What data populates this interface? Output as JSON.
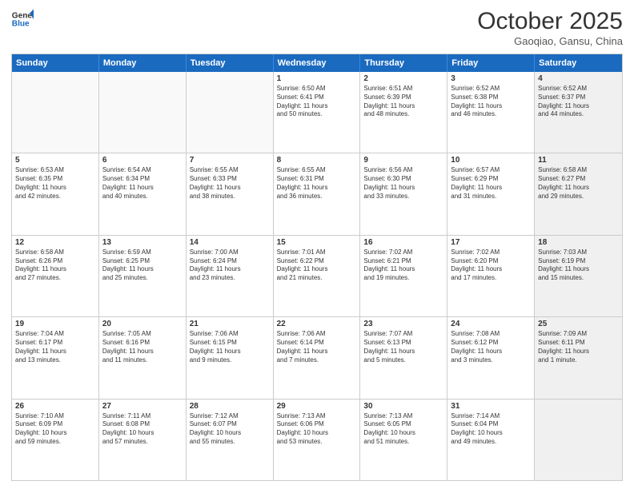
{
  "header": {
    "logo_line1": "General",
    "logo_line2": "Blue",
    "month": "October 2025",
    "location": "Gaoqiao, Gansu, China"
  },
  "weekdays": [
    "Sunday",
    "Monday",
    "Tuesday",
    "Wednesday",
    "Thursday",
    "Friday",
    "Saturday"
  ],
  "rows": [
    [
      {
        "day": "",
        "text": "",
        "empty": true
      },
      {
        "day": "",
        "text": "",
        "empty": true
      },
      {
        "day": "",
        "text": "",
        "empty": true
      },
      {
        "day": "1",
        "text": "Sunrise: 6:50 AM\nSunset: 6:41 PM\nDaylight: 11 hours\nand 50 minutes."
      },
      {
        "day": "2",
        "text": "Sunrise: 6:51 AM\nSunset: 6:39 PM\nDaylight: 11 hours\nand 48 minutes."
      },
      {
        "day": "3",
        "text": "Sunrise: 6:52 AM\nSunset: 6:38 PM\nDaylight: 11 hours\nand 46 minutes."
      },
      {
        "day": "4",
        "text": "Sunrise: 6:52 AM\nSunset: 6:37 PM\nDaylight: 11 hours\nand 44 minutes.",
        "shaded": true
      }
    ],
    [
      {
        "day": "5",
        "text": "Sunrise: 6:53 AM\nSunset: 6:35 PM\nDaylight: 11 hours\nand 42 minutes."
      },
      {
        "day": "6",
        "text": "Sunrise: 6:54 AM\nSunset: 6:34 PM\nDaylight: 11 hours\nand 40 minutes."
      },
      {
        "day": "7",
        "text": "Sunrise: 6:55 AM\nSunset: 6:33 PM\nDaylight: 11 hours\nand 38 minutes."
      },
      {
        "day": "8",
        "text": "Sunrise: 6:55 AM\nSunset: 6:31 PM\nDaylight: 11 hours\nand 36 minutes."
      },
      {
        "day": "9",
        "text": "Sunrise: 6:56 AM\nSunset: 6:30 PM\nDaylight: 11 hours\nand 33 minutes."
      },
      {
        "day": "10",
        "text": "Sunrise: 6:57 AM\nSunset: 6:29 PM\nDaylight: 11 hours\nand 31 minutes."
      },
      {
        "day": "11",
        "text": "Sunrise: 6:58 AM\nSunset: 6:27 PM\nDaylight: 11 hours\nand 29 minutes.",
        "shaded": true
      }
    ],
    [
      {
        "day": "12",
        "text": "Sunrise: 6:58 AM\nSunset: 6:26 PM\nDaylight: 11 hours\nand 27 minutes."
      },
      {
        "day": "13",
        "text": "Sunrise: 6:59 AM\nSunset: 6:25 PM\nDaylight: 11 hours\nand 25 minutes."
      },
      {
        "day": "14",
        "text": "Sunrise: 7:00 AM\nSunset: 6:24 PM\nDaylight: 11 hours\nand 23 minutes."
      },
      {
        "day": "15",
        "text": "Sunrise: 7:01 AM\nSunset: 6:22 PM\nDaylight: 11 hours\nand 21 minutes."
      },
      {
        "day": "16",
        "text": "Sunrise: 7:02 AM\nSunset: 6:21 PM\nDaylight: 11 hours\nand 19 minutes."
      },
      {
        "day": "17",
        "text": "Sunrise: 7:02 AM\nSunset: 6:20 PM\nDaylight: 11 hours\nand 17 minutes."
      },
      {
        "day": "18",
        "text": "Sunrise: 7:03 AM\nSunset: 6:19 PM\nDaylight: 11 hours\nand 15 minutes.",
        "shaded": true
      }
    ],
    [
      {
        "day": "19",
        "text": "Sunrise: 7:04 AM\nSunset: 6:17 PM\nDaylight: 11 hours\nand 13 minutes."
      },
      {
        "day": "20",
        "text": "Sunrise: 7:05 AM\nSunset: 6:16 PM\nDaylight: 11 hours\nand 11 minutes."
      },
      {
        "day": "21",
        "text": "Sunrise: 7:06 AM\nSunset: 6:15 PM\nDaylight: 11 hours\nand 9 minutes."
      },
      {
        "day": "22",
        "text": "Sunrise: 7:06 AM\nSunset: 6:14 PM\nDaylight: 11 hours\nand 7 minutes."
      },
      {
        "day": "23",
        "text": "Sunrise: 7:07 AM\nSunset: 6:13 PM\nDaylight: 11 hours\nand 5 minutes."
      },
      {
        "day": "24",
        "text": "Sunrise: 7:08 AM\nSunset: 6:12 PM\nDaylight: 11 hours\nand 3 minutes."
      },
      {
        "day": "25",
        "text": "Sunrise: 7:09 AM\nSunset: 6:11 PM\nDaylight: 11 hours\nand 1 minute.",
        "shaded": true
      }
    ],
    [
      {
        "day": "26",
        "text": "Sunrise: 7:10 AM\nSunset: 6:09 PM\nDaylight: 10 hours\nand 59 minutes."
      },
      {
        "day": "27",
        "text": "Sunrise: 7:11 AM\nSunset: 6:08 PM\nDaylight: 10 hours\nand 57 minutes."
      },
      {
        "day": "28",
        "text": "Sunrise: 7:12 AM\nSunset: 6:07 PM\nDaylight: 10 hours\nand 55 minutes."
      },
      {
        "day": "29",
        "text": "Sunrise: 7:13 AM\nSunset: 6:06 PM\nDaylight: 10 hours\nand 53 minutes."
      },
      {
        "day": "30",
        "text": "Sunrise: 7:13 AM\nSunset: 6:05 PM\nDaylight: 10 hours\nand 51 minutes."
      },
      {
        "day": "31",
        "text": "Sunrise: 7:14 AM\nSunset: 6:04 PM\nDaylight: 10 hours\nand 49 minutes."
      },
      {
        "day": "",
        "text": "",
        "empty": true,
        "shaded": true
      }
    ]
  ]
}
